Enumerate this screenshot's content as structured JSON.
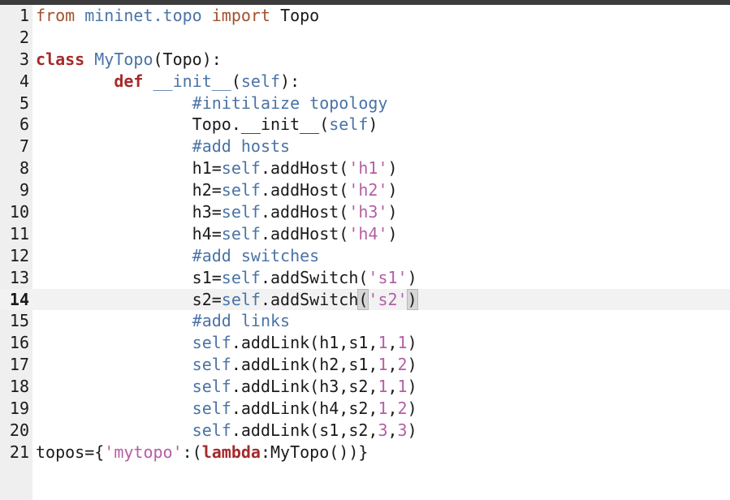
{
  "editor": {
    "current_line": 14,
    "lines": [
      {
        "n": "1",
        "tokens": [
          [
            "from ",
            "kw-import"
          ],
          [
            "mininet.topo ",
            "kw-mod"
          ],
          [
            "import ",
            "kw-import"
          ],
          [
            "Topo",
            ""
          ]
        ]
      },
      {
        "n": "2",
        "tokens": []
      },
      {
        "n": "3",
        "tokens": [
          [
            "class ",
            "kw-class"
          ],
          [
            "MyTopo",
            "cls-name"
          ],
          [
            "(Topo):",
            ""
          ]
        ]
      },
      {
        "n": "4",
        "tokens": [
          [
            "        ",
            ""
          ],
          [
            "def ",
            "kw-class"
          ],
          [
            "__init__",
            "fn-name"
          ],
          [
            "(",
            ""
          ],
          [
            "self",
            "self"
          ],
          [
            "):",
            ""
          ]
        ]
      },
      {
        "n": "5",
        "tokens": [
          [
            "                ",
            ""
          ],
          [
            "#initilaize topology",
            "comment"
          ]
        ]
      },
      {
        "n": "6",
        "tokens": [
          [
            "                ",
            ""
          ],
          [
            "Topo.__init__(",
            ""
          ],
          [
            "self",
            "self"
          ],
          [
            ")",
            ""
          ]
        ]
      },
      {
        "n": "7",
        "tokens": [
          [
            "                ",
            ""
          ],
          [
            "#add hosts",
            "comment"
          ]
        ]
      },
      {
        "n": "8",
        "tokens": [
          [
            "                ",
            ""
          ],
          [
            "h1=",
            ""
          ],
          [
            "self",
            "self"
          ],
          [
            ".addHost(",
            ""
          ],
          [
            "'h1'",
            "str"
          ],
          [
            ")",
            ""
          ]
        ]
      },
      {
        "n": "9",
        "tokens": [
          [
            "                ",
            ""
          ],
          [
            "h2=",
            ""
          ],
          [
            "self",
            "self"
          ],
          [
            ".addHost(",
            ""
          ],
          [
            "'h2'",
            "str"
          ],
          [
            ")",
            ""
          ]
        ]
      },
      {
        "n": "10",
        "tokens": [
          [
            "                ",
            ""
          ],
          [
            "h3=",
            ""
          ],
          [
            "self",
            "self"
          ],
          [
            ".addHost(",
            ""
          ],
          [
            "'h3'",
            "str"
          ],
          [
            ")",
            ""
          ]
        ]
      },
      {
        "n": "11",
        "tokens": [
          [
            "                ",
            ""
          ],
          [
            "h4=",
            ""
          ],
          [
            "self",
            "self"
          ],
          [
            ".addHost(",
            ""
          ],
          [
            "'h4'",
            "str"
          ],
          [
            ")",
            ""
          ]
        ]
      },
      {
        "n": "12",
        "tokens": [
          [
            "                ",
            ""
          ],
          [
            "#add switches",
            "comment"
          ]
        ]
      },
      {
        "n": "13",
        "tokens": [
          [
            "                ",
            ""
          ],
          [
            "s1=",
            ""
          ],
          [
            "self",
            "self"
          ],
          [
            ".addSwitch(",
            ""
          ],
          [
            "'s1'",
            "str"
          ],
          [
            ")",
            ""
          ]
        ]
      },
      {
        "n": "14",
        "tokens": [
          [
            "                ",
            ""
          ],
          [
            "s2=",
            ""
          ],
          [
            "self",
            "self"
          ],
          [
            ".addSwitch",
            ""
          ],
          [
            "(",
            "bracket-hl"
          ],
          [
            "'s2'",
            "str"
          ],
          [
            ")",
            "bracket-hl"
          ]
        ]
      },
      {
        "n": "15",
        "tokens": [
          [
            "                ",
            ""
          ],
          [
            "#add links",
            "comment"
          ]
        ]
      },
      {
        "n": "16",
        "tokens": [
          [
            "                ",
            ""
          ],
          [
            "self",
            "self"
          ],
          [
            ".addLink(h1,s1,",
            ""
          ],
          [
            "1",
            "num"
          ],
          [
            ",",
            ""
          ],
          [
            "1",
            "num"
          ],
          [
            ")",
            ""
          ]
        ]
      },
      {
        "n": "17",
        "tokens": [
          [
            "                ",
            ""
          ],
          [
            "self",
            "self"
          ],
          [
            ".addLink(h2,s1,",
            ""
          ],
          [
            "1",
            "num"
          ],
          [
            ",",
            ""
          ],
          [
            "2",
            "num"
          ],
          [
            ")",
            ""
          ]
        ]
      },
      {
        "n": "18",
        "tokens": [
          [
            "                ",
            ""
          ],
          [
            "self",
            "self"
          ],
          [
            ".addLink(h3,s2,",
            ""
          ],
          [
            "1",
            "num"
          ],
          [
            ",",
            ""
          ],
          [
            "1",
            "num"
          ],
          [
            ")",
            ""
          ]
        ]
      },
      {
        "n": "19",
        "tokens": [
          [
            "                ",
            ""
          ],
          [
            "self",
            "self"
          ],
          [
            ".addLink(h4,s2,",
            ""
          ],
          [
            "1",
            "num"
          ],
          [
            ",",
            ""
          ],
          [
            "2",
            "num"
          ],
          [
            ")",
            ""
          ]
        ]
      },
      {
        "n": "20",
        "tokens": [
          [
            "                ",
            ""
          ],
          [
            "self",
            "self"
          ],
          [
            ".addLink(s1,s2,",
            ""
          ],
          [
            "3",
            "num"
          ],
          [
            ",",
            ""
          ],
          [
            "3",
            "num"
          ],
          [
            ")",
            ""
          ]
        ]
      },
      {
        "n": "21",
        "tokens": [
          [
            "topos={",
            ""
          ],
          [
            "'mytopo'",
            "str"
          ],
          [
            ":(",
            ""
          ],
          [
            "lambda",
            "kw-class"
          ],
          [
            ":MyTopo())}",
            ""
          ]
        ]
      }
    ]
  }
}
